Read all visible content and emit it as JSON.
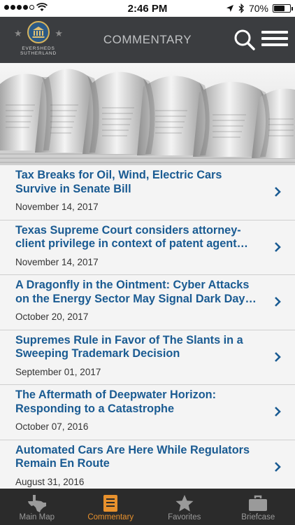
{
  "status_bar": {
    "time": "2:46 PM",
    "battery": "70%",
    "battery_level": 0.7
  },
  "header": {
    "title": "COMMENTARY",
    "logo_line1": "EVERSHEDS",
    "logo_line2": "SUTHERLAND"
  },
  "articles": [
    {
      "title": "Tax Breaks for Oil, Wind, Electric Cars Survive in Senate Bill",
      "date": "November 14, 2017"
    },
    {
      "title": "Texas Supreme Court considers attorney-client privilege in context of patent agent…",
      "date": "November 14, 2017"
    },
    {
      "title": "A Dragonfly in the Ointment: Cyber Attacks on the Energy Sector May Signal Dark Day…",
      "date": "October 20, 2017"
    },
    {
      "title": "Supremes Rule in Favor of The Slants in a Sweeping Trademark Decision",
      "date": "September 01, 2017"
    },
    {
      "title": "The Aftermath of Deepwater Horizon: Responding to a Catastrophe",
      "date": "October 07, 2016"
    },
    {
      "title": "Automated Cars Are Here While Regulators Remain En Route",
      "date": "August 31, 2016"
    }
  ],
  "tabs": [
    {
      "label": "Main Map",
      "icon": "texas-map-icon"
    },
    {
      "label": "Commentary",
      "icon": "document-icon",
      "active": true
    },
    {
      "label": "Favorites",
      "icon": "star-icon"
    },
    {
      "label": "Briefcase",
      "icon": "briefcase-icon"
    }
  ],
  "colors": {
    "header_bg": "#3b3d40",
    "link_blue": "#1a5b92",
    "accent_orange": "#e8912d",
    "tabbar_bg": "#2b2b2b"
  }
}
